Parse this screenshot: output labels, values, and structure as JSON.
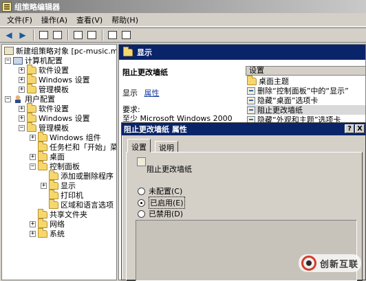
{
  "window": {
    "title": "组策略编辑器"
  },
  "menu": [
    {
      "label": "文件(F)"
    },
    {
      "label": "操作(A)"
    },
    {
      "label": "查看(V)"
    },
    {
      "label": "帮助(H)"
    }
  ],
  "tree": {
    "root": "新建组策略对象 [pc-music.mus",
    "computer_config": "计算机配置",
    "cc_software": "软件设置",
    "cc_windows": "Windows 设置",
    "cc_admin": "管理模板",
    "user_config": "用户配置",
    "uc_software": "软件设置",
    "uc_windows": "Windows 设置",
    "uc_admin": "管理模板",
    "windows_components": "Windows 组件",
    "taskbar": "任务栏和「开始」菜",
    "desktop": "桌面",
    "control_panel": "控制面板",
    "add_remove": "添加或删除程序",
    "display": "显示",
    "printers": "打印机",
    "region": "区域和语言选项",
    "shared": "共享文件夹",
    "network": "网络",
    "system": "系统"
  },
  "right_pane": {
    "header": "显示",
    "setting_title": "阻止更改墙纸",
    "show_label": "显示",
    "show_link": "属性",
    "requirements_label": "要求:",
    "requirements_value": "至少 Microsoft Windows 2000",
    "list_header": "设置",
    "list_items": [
      "桌面主题",
      "删除“控制面板”中的“显示”",
      "隐藏“桌面”选项卡",
      "阻止更改墙纸",
      "隐藏“外观和主题”选项卡"
    ]
  },
  "dialog": {
    "title": "阻止更改墙纸 属性",
    "help_button": "?",
    "close_button": "X",
    "tabs": [
      "设置",
      "说明"
    ],
    "policy_name": "阻止更改墙纸",
    "options": [
      "未配置(C)",
      "已启用(E)",
      "已禁用(D)"
    ],
    "selected_option": "已启用(E)"
  },
  "watermark": {
    "text": "创新互联"
  },
  "colors": {
    "selection": "#0a246a",
    "face": "#d4d0c8"
  }
}
